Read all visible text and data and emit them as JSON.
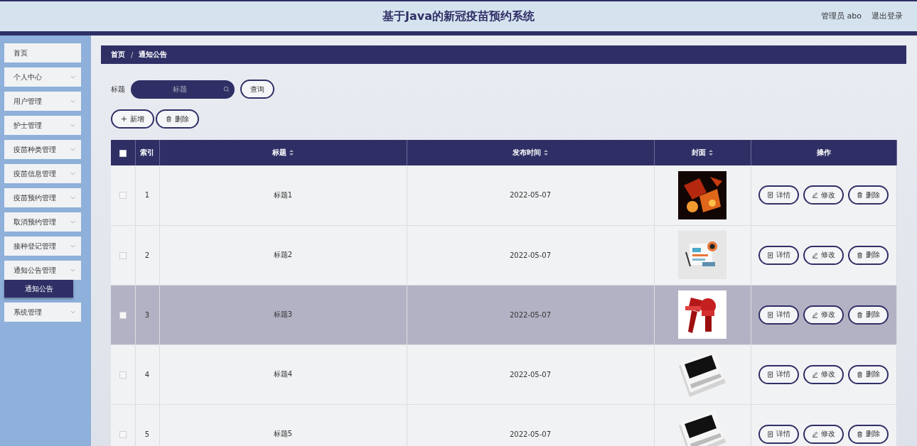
{
  "header": {
    "title": "基于Java的新冠疫苗预约系统",
    "user": "管理员 abo",
    "logout": "退出登录"
  },
  "sidebar": {
    "items": [
      {
        "label": "首页",
        "expandable": false
      },
      {
        "label": "个人中心",
        "expandable": true
      },
      {
        "label": "用户管理",
        "expandable": true
      },
      {
        "label": "护士管理",
        "expandable": true
      },
      {
        "label": "疫苗种类管理",
        "expandable": true
      },
      {
        "label": "疫苗信息管理",
        "expandable": true
      },
      {
        "label": "疫苗预约管理",
        "expandable": true
      },
      {
        "label": "取消预约管理",
        "expandable": true
      },
      {
        "label": "接种登记管理",
        "expandable": true
      },
      {
        "label": "通知公告管理",
        "expandable": true,
        "children": [
          {
            "label": "通知公告",
            "selected": true
          }
        ]
      },
      {
        "label": "系统管理",
        "expandable": true
      }
    ]
  },
  "breadcrumb": {
    "items": [
      "首页",
      "通知公告"
    ],
    "separator": "/"
  },
  "search": {
    "label": "标题",
    "placeholder": "标题",
    "button": "查询"
  },
  "actions": [
    {
      "kind": "add",
      "label": "新增"
    },
    {
      "kind": "delete",
      "label": "删除"
    }
  ],
  "table": {
    "columns": [
      {
        "kind": "checkbox",
        "checked": false
      },
      {
        "kind": "text",
        "label": "索引",
        "sortable": false
      },
      {
        "kind": "text",
        "label": "标题",
        "sortable": true
      },
      {
        "kind": "text",
        "label": "发布时间",
        "sortable": true
      },
      {
        "kind": "text",
        "label": "封面",
        "sortable": true
      },
      {
        "kind": "text",
        "label": "操作",
        "sortable": false
      }
    ],
    "rows": [
      {
        "checked": false,
        "highlighted": false,
        "index": "1",
        "title": "标题1",
        "date": "2022-05-07",
        "actions": [
          {
            "kind": "detail",
            "label": "详情"
          },
          {
            "kind": "edit",
            "label": "修改"
          },
          {
            "kind": "delete",
            "label": "删除"
          }
        ]
      },
      {
        "checked": false,
        "highlighted": false,
        "index": "2",
        "title": "标题2",
        "date": "2022-05-07",
        "actions": [
          {
            "kind": "detail",
            "label": "详情"
          },
          {
            "kind": "edit",
            "label": "修改"
          },
          {
            "kind": "delete",
            "label": "删除"
          }
        ]
      },
      {
        "checked": false,
        "highlighted": true,
        "index": "3",
        "title": "标题3",
        "date": "2022-05-07",
        "actions": [
          {
            "kind": "detail",
            "label": "详情"
          },
          {
            "kind": "edit",
            "label": "修改"
          },
          {
            "kind": "delete",
            "label": "删除"
          }
        ]
      },
      {
        "checked": false,
        "highlighted": false,
        "index": "4",
        "title": "标题4",
        "date": "2022-05-07",
        "actions": [
          {
            "kind": "detail",
            "label": "详情"
          },
          {
            "kind": "edit",
            "label": "修改"
          },
          {
            "kind": "delete",
            "label": "删除"
          }
        ]
      },
      {
        "checked": false,
        "highlighted": false,
        "index": "5",
        "title": "标题5",
        "date": "2022-05-07",
        "actions": [
          {
            "kind": "detail",
            "label": "详情"
          },
          {
            "kind": "edit",
            "label": "修改"
          },
          {
            "kind": "delete",
            "label": "删除"
          }
        ]
      }
    ]
  }
}
